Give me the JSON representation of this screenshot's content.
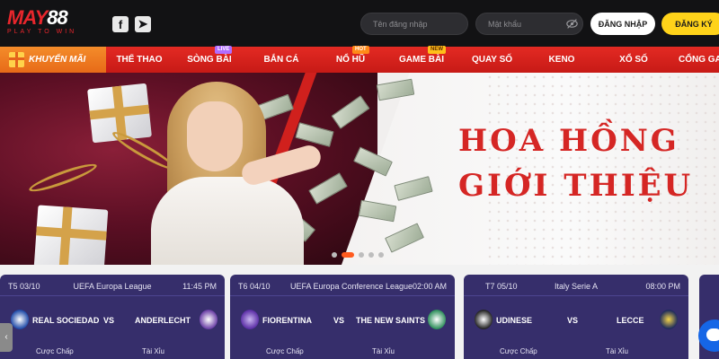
{
  "header": {
    "logo": {
      "main_red": "MAY",
      "main_white": "88",
      "tagline": "PLAY TO WIN"
    },
    "social": [
      {
        "name": "facebook-icon",
        "glyph": "f"
      },
      {
        "name": "telegram-icon",
        "glyph": "➤"
      }
    ],
    "username_placeholder": "Tên đăng nhập",
    "password_placeholder": "Mật khẩu",
    "login_label": "ĐĂNG NHẬP",
    "register_label": "ĐĂNG KÝ"
  },
  "nav": {
    "promo_label": "KHUYẾN MÃI",
    "items": [
      {
        "label": "THỂ THAO",
        "badge": ""
      },
      {
        "label": "SÒNG BÀI",
        "badge": "LIVE"
      },
      {
        "label": "BẮN CÁ",
        "badge": ""
      },
      {
        "label": "NỔ HŨ",
        "badge": "HOT"
      },
      {
        "label": "GAME BÀI",
        "badge": "NEW"
      },
      {
        "label": "QUAY SỐ",
        "badge": ""
      },
      {
        "label": "KENO",
        "badge": ""
      },
      {
        "label": "XỔ SỐ",
        "badge": ""
      },
      {
        "label": "CỔNG GAM",
        "badge": ""
      }
    ]
  },
  "banner": {
    "title_line1": "HOA HỒNG",
    "title_line2": "GIỚI THIỆU",
    "slides": 5,
    "active_slide": 2
  },
  "matches": [
    {
      "date": "T5 03/10",
      "league": "UEFA Europa League",
      "time": "11:45 PM",
      "home": "REAL SOCIEDAD",
      "vs": "VS",
      "away": "ANDERLECHT",
      "odds1": "Cược Chấp",
      "odds2": "Tài Xỉu"
    },
    {
      "date": "T6 04/10",
      "league": "UEFA Europa Conference League",
      "time": "02:00 AM",
      "home": "FIORENTINA",
      "vs": "VS",
      "away": "THE NEW SAINTS",
      "odds1": "Cược Chấp",
      "odds2": "Tài Xỉu"
    },
    {
      "date": "T7 05/10",
      "league": "Italy Serie A",
      "time": "08:00 PM",
      "home": "UDINESE",
      "vs": "VS",
      "away": "LECCE",
      "odds1": "Cược Chấp",
      "odds2": "Tài Xỉu"
    }
  ],
  "colors": {
    "brand_red": "#e8262c",
    "nav_red": "#d3201b",
    "promo_orange": "#f07a22",
    "register_yellow": "#ffd31a",
    "card_purple": "#362e6b",
    "title_red": "#d52624"
  }
}
